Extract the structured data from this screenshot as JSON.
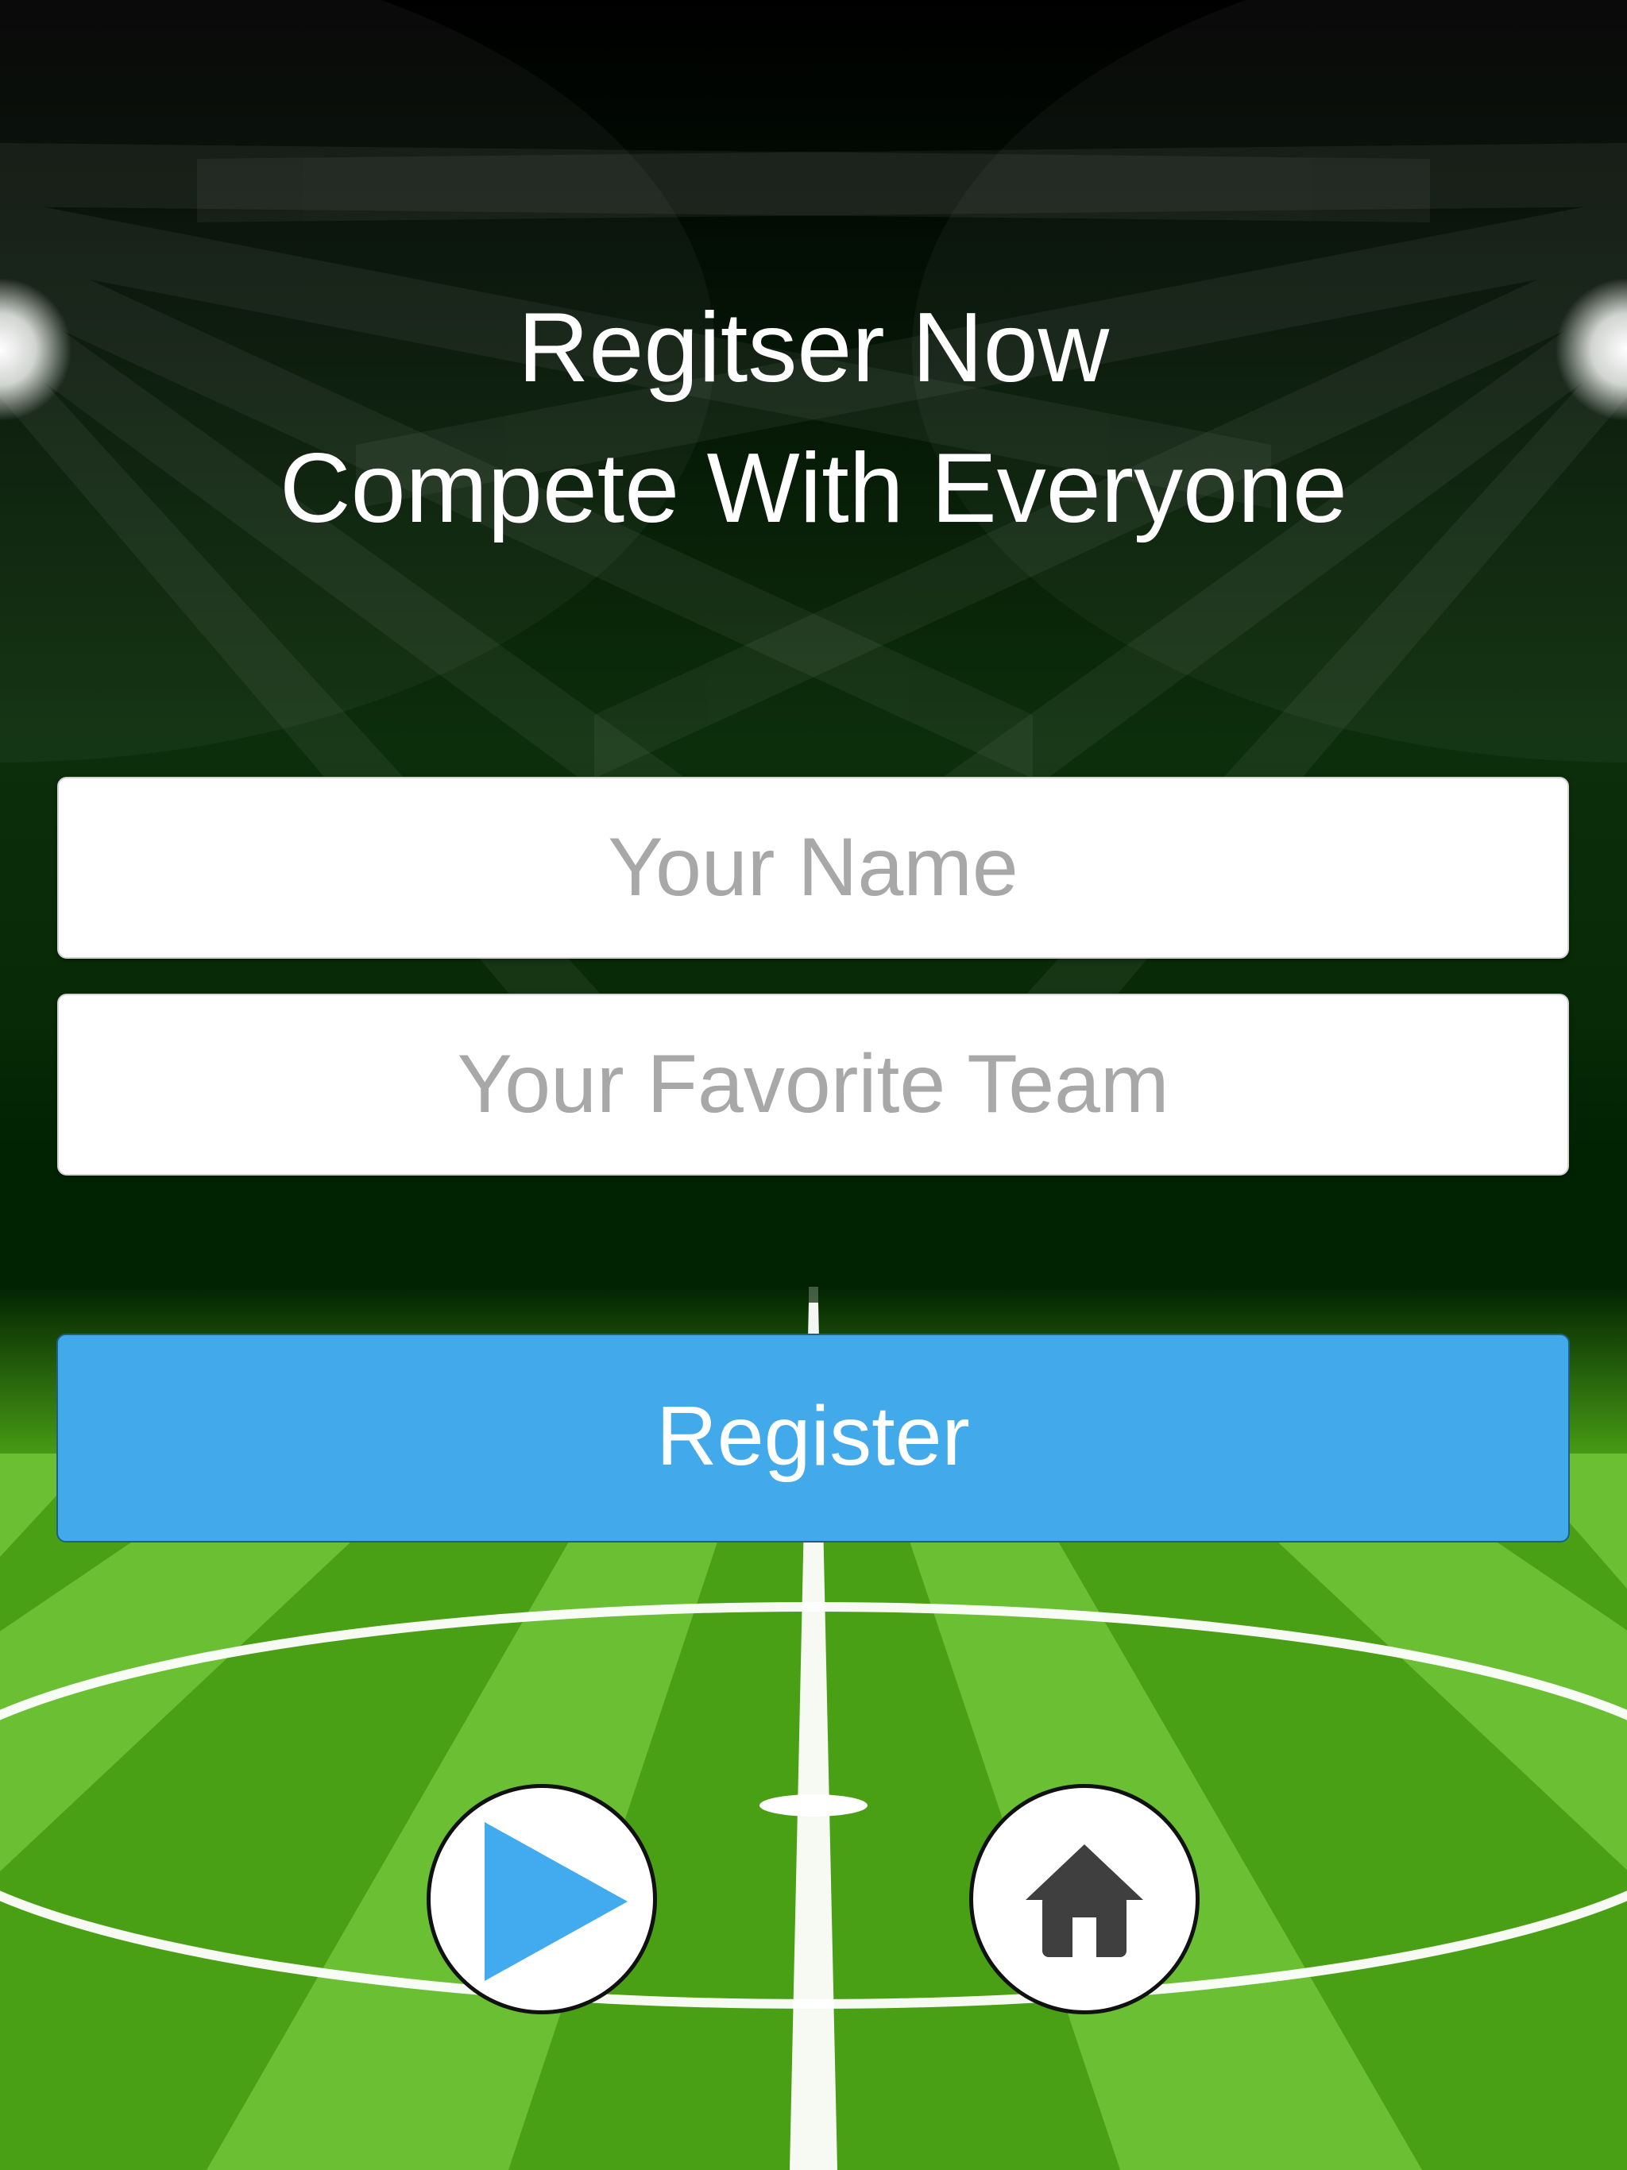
{
  "header": {
    "line1": "Regitser Now",
    "line2": "Compete With Everyone"
  },
  "form": {
    "name_placeholder": "Your Name",
    "team_placeholder": "Your Favorite Team",
    "register_label": "Register"
  },
  "controls": {
    "play_icon": "play-icon",
    "home_icon": "home-icon"
  },
  "colors": {
    "accent": "#42a9ea",
    "pitch_light": "#6abf32",
    "pitch_dark": "#4aa015",
    "sky_dark": "#000000",
    "stadium_green": "#0f3a0c",
    "home_icon": "#3f3f3f"
  }
}
